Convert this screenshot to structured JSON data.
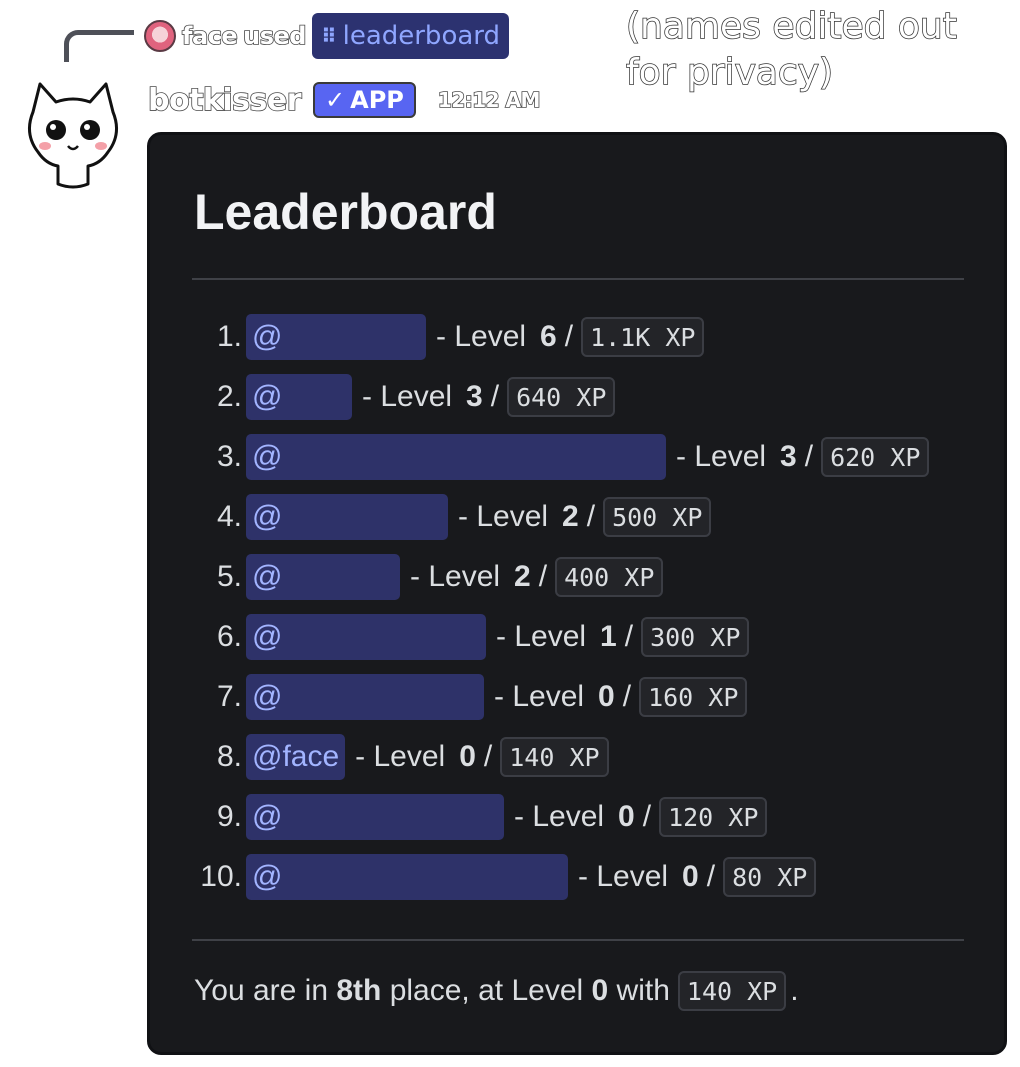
{
  "reply": {
    "user": "face",
    "verb": "used",
    "command_icon": "slash-command-icon",
    "command": "leaderboard"
  },
  "note": "(names edited out for privacy)",
  "message": {
    "username": "botkisser",
    "badge": "APP",
    "badge_check": "✓",
    "timestamp": "12:12 AM"
  },
  "embed": {
    "title": "Leaderboard",
    "entries": [
      {
        "rank": "1.",
        "mention": "@",
        "level_prefix": "- Level",
        "level": "6",
        "slash": "/",
        "xp": "1.1K XP"
      },
      {
        "rank": "2.",
        "mention": "@",
        "level_prefix": "- Level",
        "level": "3",
        "slash": "/",
        "xp": "640 XP"
      },
      {
        "rank": "3.",
        "mention": "@",
        "level_prefix": "- Level",
        "level": "3",
        "slash": "/",
        "xp": "620 XP"
      },
      {
        "rank": "4.",
        "mention": "@",
        "level_prefix": "- Level",
        "level": "2",
        "slash": "/",
        "xp": "500 XP"
      },
      {
        "rank": "5.",
        "mention": "@",
        "level_prefix": "- Level",
        "level": "2",
        "slash": "/",
        "xp": "400 XP"
      },
      {
        "rank": "6.",
        "mention": "@",
        "level_prefix": "- Level",
        "level": "1",
        "slash": "/",
        "xp": "300 XP"
      },
      {
        "rank": "7.",
        "mention": "@",
        "level_prefix": "- Level",
        "level": "0",
        "slash": "/",
        "xp": "160 XP"
      },
      {
        "rank": "8.",
        "mention": "@face",
        "level_prefix": "- Level",
        "level": "0",
        "slash": "/",
        "xp": "140 XP"
      },
      {
        "rank": "9.",
        "mention": "@",
        "level_prefix": "- Level",
        "level": "0",
        "slash": "/",
        "xp": "120 XP"
      },
      {
        "rank": "10.",
        "mention": "@",
        "level_prefix": "- Level",
        "level": "0",
        "slash": "/",
        "xp": "80 XP"
      }
    ],
    "footer": {
      "prefix": "You are in",
      "place": "8th",
      "middle": "place, at Level",
      "level": "0",
      "with": "with",
      "xp": "140 XP",
      "end": "."
    }
  },
  "colors": {
    "embed_bg": "#18191c",
    "mention_bg": "#2e3269",
    "mention_text": "#a2b4ff",
    "app_badge": "#5865f2"
  }
}
